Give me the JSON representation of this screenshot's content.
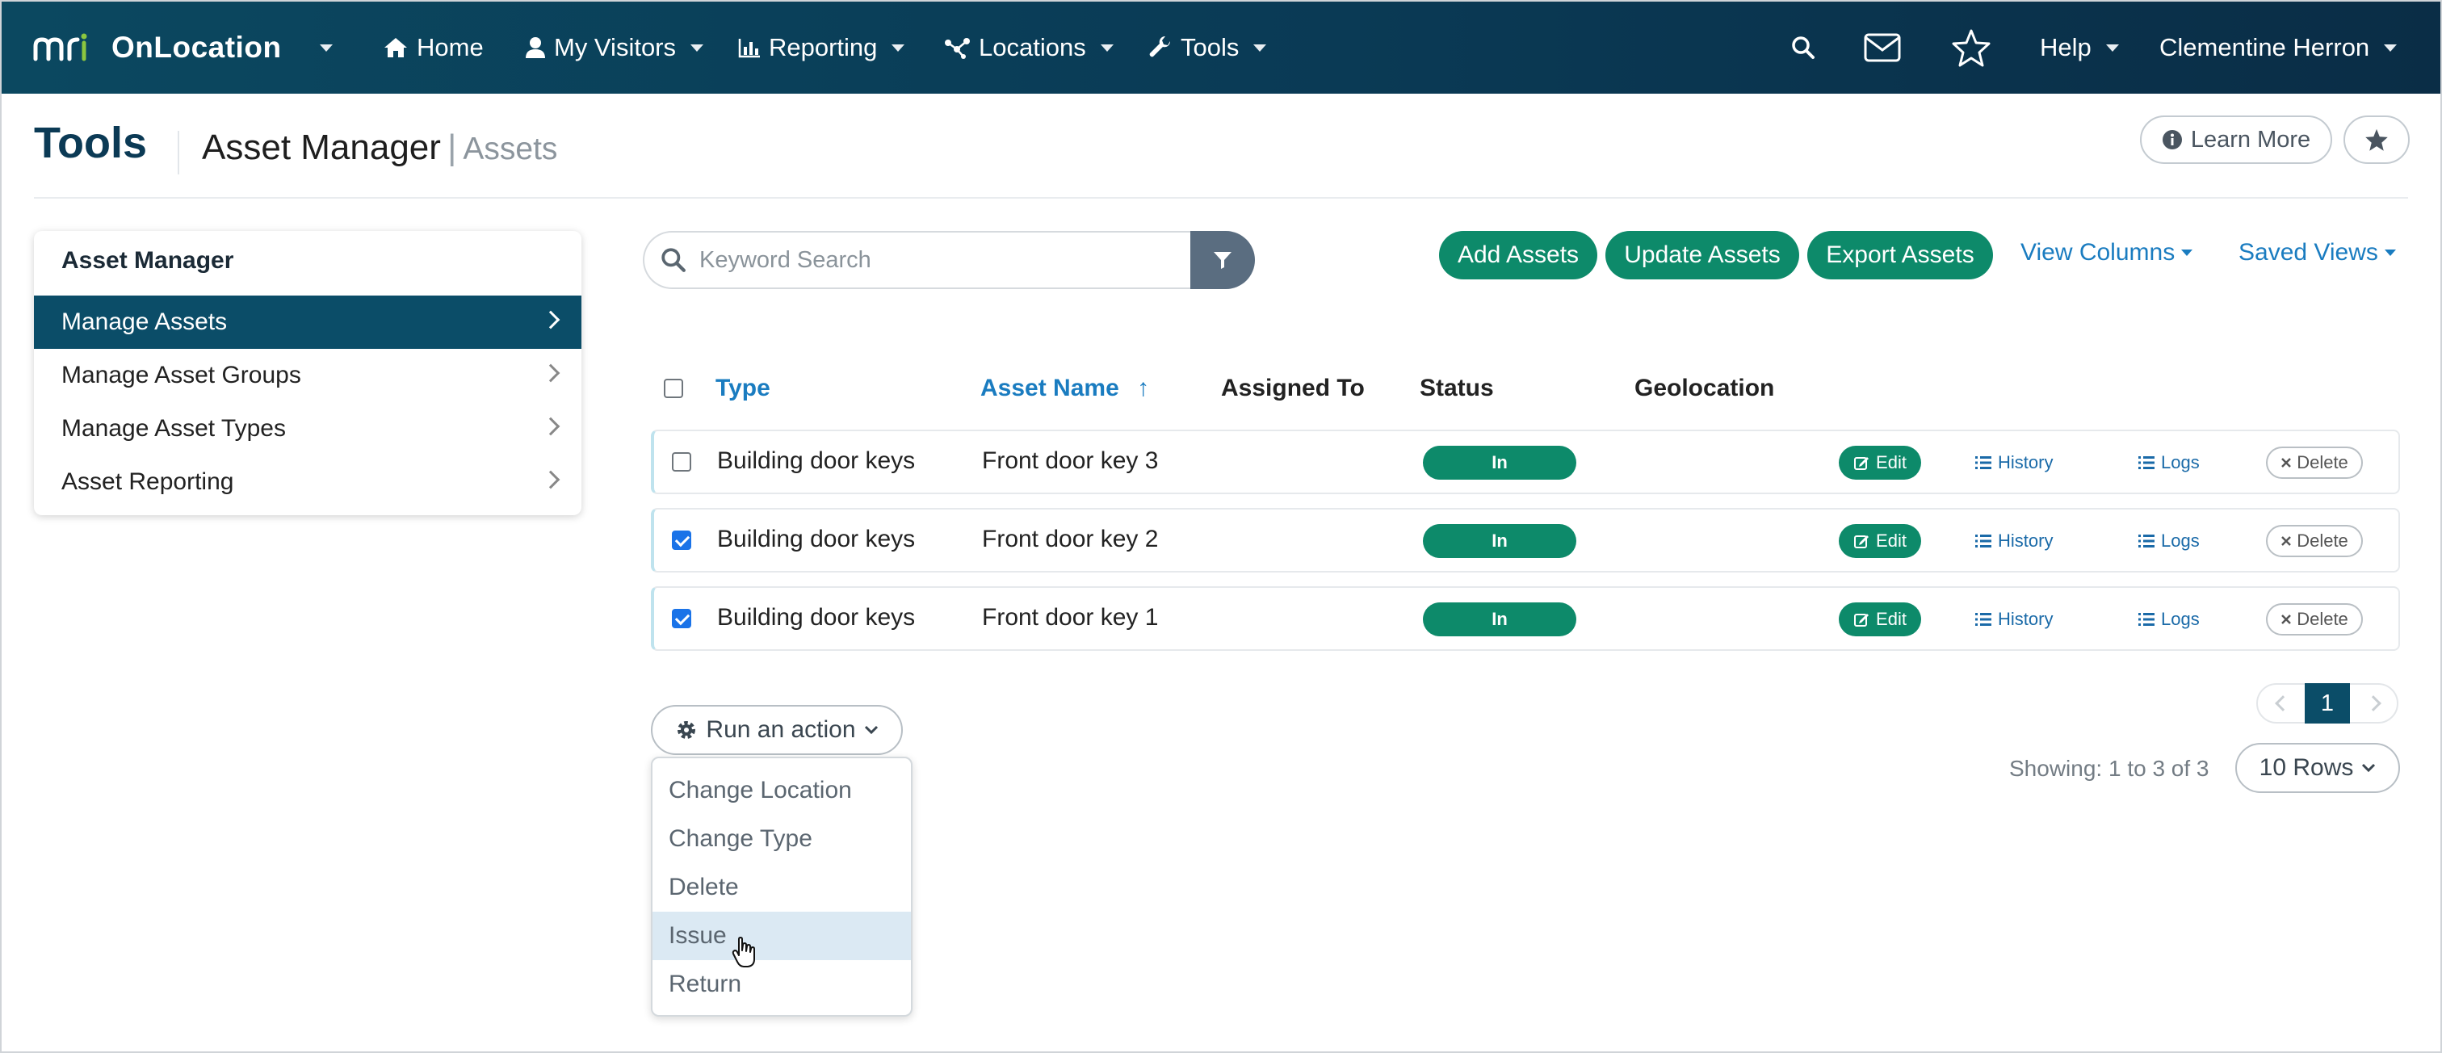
{
  "nav": {
    "brand": "OnLocation",
    "items": [
      {
        "label": "Home",
        "icon": "home-icon"
      },
      {
        "label": "My Visitors",
        "icon": "user-icon"
      },
      {
        "label": "Reporting",
        "icon": "bar-chart-icon"
      },
      {
        "label": "Locations",
        "icon": "network-icon"
      },
      {
        "label": "Tools",
        "icon": "wrench-icon"
      }
    ],
    "help": "Help",
    "user": "Clementine Herron"
  },
  "header": {
    "title": "Tools",
    "subtitle": "Asset Manager",
    "separator": "|",
    "crumb": "Assets",
    "learn_more": "Learn More"
  },
  "sidebar": {
    "title": "Asset Manager",
    "items": [
      {
        "label": "Manage Assets",
        "active": true
      },
      {
        "label": "Manage Asset Groups",
        "active": false
      },
      {
        "label": "Manage Asset Types",
        "active": false
      },
      {
        "label": "Asset Reporting",
        "active": false
      }
    ]
  },
  "toolbar": {
    "search_placeholder": "Keyword Search",
    "add": "Add Assets",
    "update": "Update Assets",
    "export": "Export Assets",
    "view_columns": "View Columns",
    "saved_views": "Saved Views"
  },
  "table": {
    "headers": {
      "type": "Type",
      "asset_name": "Asset Name",
      "sort_arrow": "↑",
      "assigned_to": "Assigned To",
      "status": "Status",
      "geolocation": "Geolocation"
    },
    "rows": [
      {
        "type": "Building door keys",
        "name": "Front door key 3",
        "assigned": "",
        "status": "In",
        "checked": false
      },
      {
        "type": "Building door keys",
        "name": "Front door key 2",
        "assigned": "",
        "status": "In",
        "checked": true
      },
      {
        "type": "Building door keys",
        "name": "Front door key 1",
        "assigned": "",
        "status": "In",
        "checked": true
      }
    ],
    "actions": {
      "edit": "Edit",
      "history": "History",
      "logs": "Logs",
      "delete": "Delete"
    }
  },
  "run_action": {
    "label": "Run an action",
    "menu": [
      "Change Location",
      "Change Type",
      "Delete",
      "Issue",
      "Return"
    ],
    "hovered": "Issue"
  },
  "pagination": {
    "current_page": "1",
    "showing": "Showing: 1 to 3 of 3",
    "rows": "10 Rows"
  },
  "colors": {
    "nav_bg": "#0b4860",
    "primary_green": "#0d8a6a",
    "active_blue": "#0b4d68",
    "link_blue": "#1a7cc0"
  }
}
